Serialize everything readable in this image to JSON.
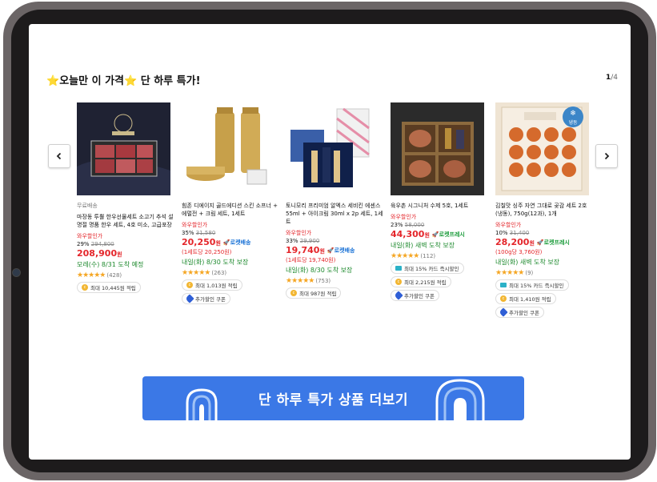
{
  "section": {
    "title": "오늘만 이 가격",
    "title_suffix": "단 하루 특가!",
    "star_glyph": "⭐",
    "pager_current": "1",
    "pager_total": "/4"
  },
  "products": [
    {
      "sub_label": "무료배송",
      "name": "마장동 투뿔 한우선물세트 소고기 추석 설 명절 명품 한우 세트, 4호 미소, 고급포장",
      "wow_label": "와우할인가",
      "discount": "29%",
      "original_price": "294,800",
      "price": "208,900",
      "currency": "원",
      "delivery": "모레(수) 8/31 도착 예정",
      "rating_count": "(428)",
      "chips": [
        {
          "type": "coin",
          "text": "최대 10,445원 적립"
        }
      ]
    },
    {
      "sub_label": "",
      "name": "힘존 디에이지 골드에디션 스킨 소프너 + 에멀전 + 크림 세트, 1세트",
      "wow_label": "와우할인가",
      "discount": "35%",
      "original_price": "31,580",
      "price": "20,250",
      "currency": "원",
      "rocket": "로켓배송",
      "unit_price": "(1세트당 20,250원)",
      "delivery": "내일(화) 8/30 도착 보장",
      "rating_count": "(263)",
      "chips": [
        {
          "type": "coin",
          "text": "최대 1,013원 적립"
        },
        {
          "type": "tag",
          "text": "추가할인 쿠폰"
        }
      ]
    },
    {
      "sub_label": "",
      "name": "토니모리 프리미엄 알엑스 세비킨 에센스 55ml + 아이크림 30ml x 2p 세트, 1세트",
      "wow_label": "와우할인가",
      "discount": "33%",
      "original_price": "29,900",
      "price": "19,740",
      "currency": "원",
      "rocket": "로켓배송",
      "unit_price": "(1세트당 19,740원)",
      "delivery": "내일(화) 8/30 도착 보장",
      "rating_count": "(753)",
      "chips": [
        {
          "type": "coin",
          "text": "최대 987원 적립"
        }
      ]
    },
    {
      "sub_label": "",
      "name": "육우촌 시그니처 수제 5호, 1세트",
      "wow_label": "와우할인가",
      "discount": "23%",
      "original_price": "58,000",
      "price": "44,300",
      "currency": "원",
      "fresh": "로켓프레시",
      "delivery": "내일(화) 새벽 도착 보장",
      "rating_count": "(112)",
      "chips": [
        {
          "type": "card",
          "text": "최대 15% 카드 즉시할인"
        },
        {
          "type": "coin",
          "text": "최대 2,215원 적립"
        },
        {
          "type": "tag",
          "text": "추가할인 쿠폰"
        }
      ]
    },
    {
      "sub_label": "",
      "name": "김칠맛 싱주 자연 그대로 곶감 세트 2호 (냉동), 750g(12과), 1개",
      "wow_label": "와우할인가",
      "discount": "10%",
      "original_price": "31,400",
      "price": "28,200",
      "currency": "원",
      "fresh": "로켓프레시",
      "unit_price": "(100g당 3,760원)",
      "delivery": "내일(화) 새벽 도착 보장",
      "rating_count": "(9)",
      "frozen_label": "냉동",
      "chips": [
        {
          "type": "card",
          "text": "최대 15% 카드 즉시할인"
        },
        {
          "type": "coin",
          "text": "최대 1,410원 적립"
        },
        {
          "type": "tag",
          "text": "추가할인 쿠폰"
        }
      ]
    }
  ],
  "stars_glyph": "★★★★★",
  "coin_glyph": "c",
  "rocket_glyph": "🚀",
  "cta": {
    "label": "단 하루 특가 상품 더보기"
  },
  "icons": {
    "prev": "chevron-left-icon",
    "next": "chevron-right-icon"
  },
  "colors": {
    "price_red": "#e4252a",
    "rocket_blue": "#1a72d6",
    "fresh_green": "#1a9b3a",
    "cta_blue": "#3b78e6",
    "star": "#f5a623"
  }
}
